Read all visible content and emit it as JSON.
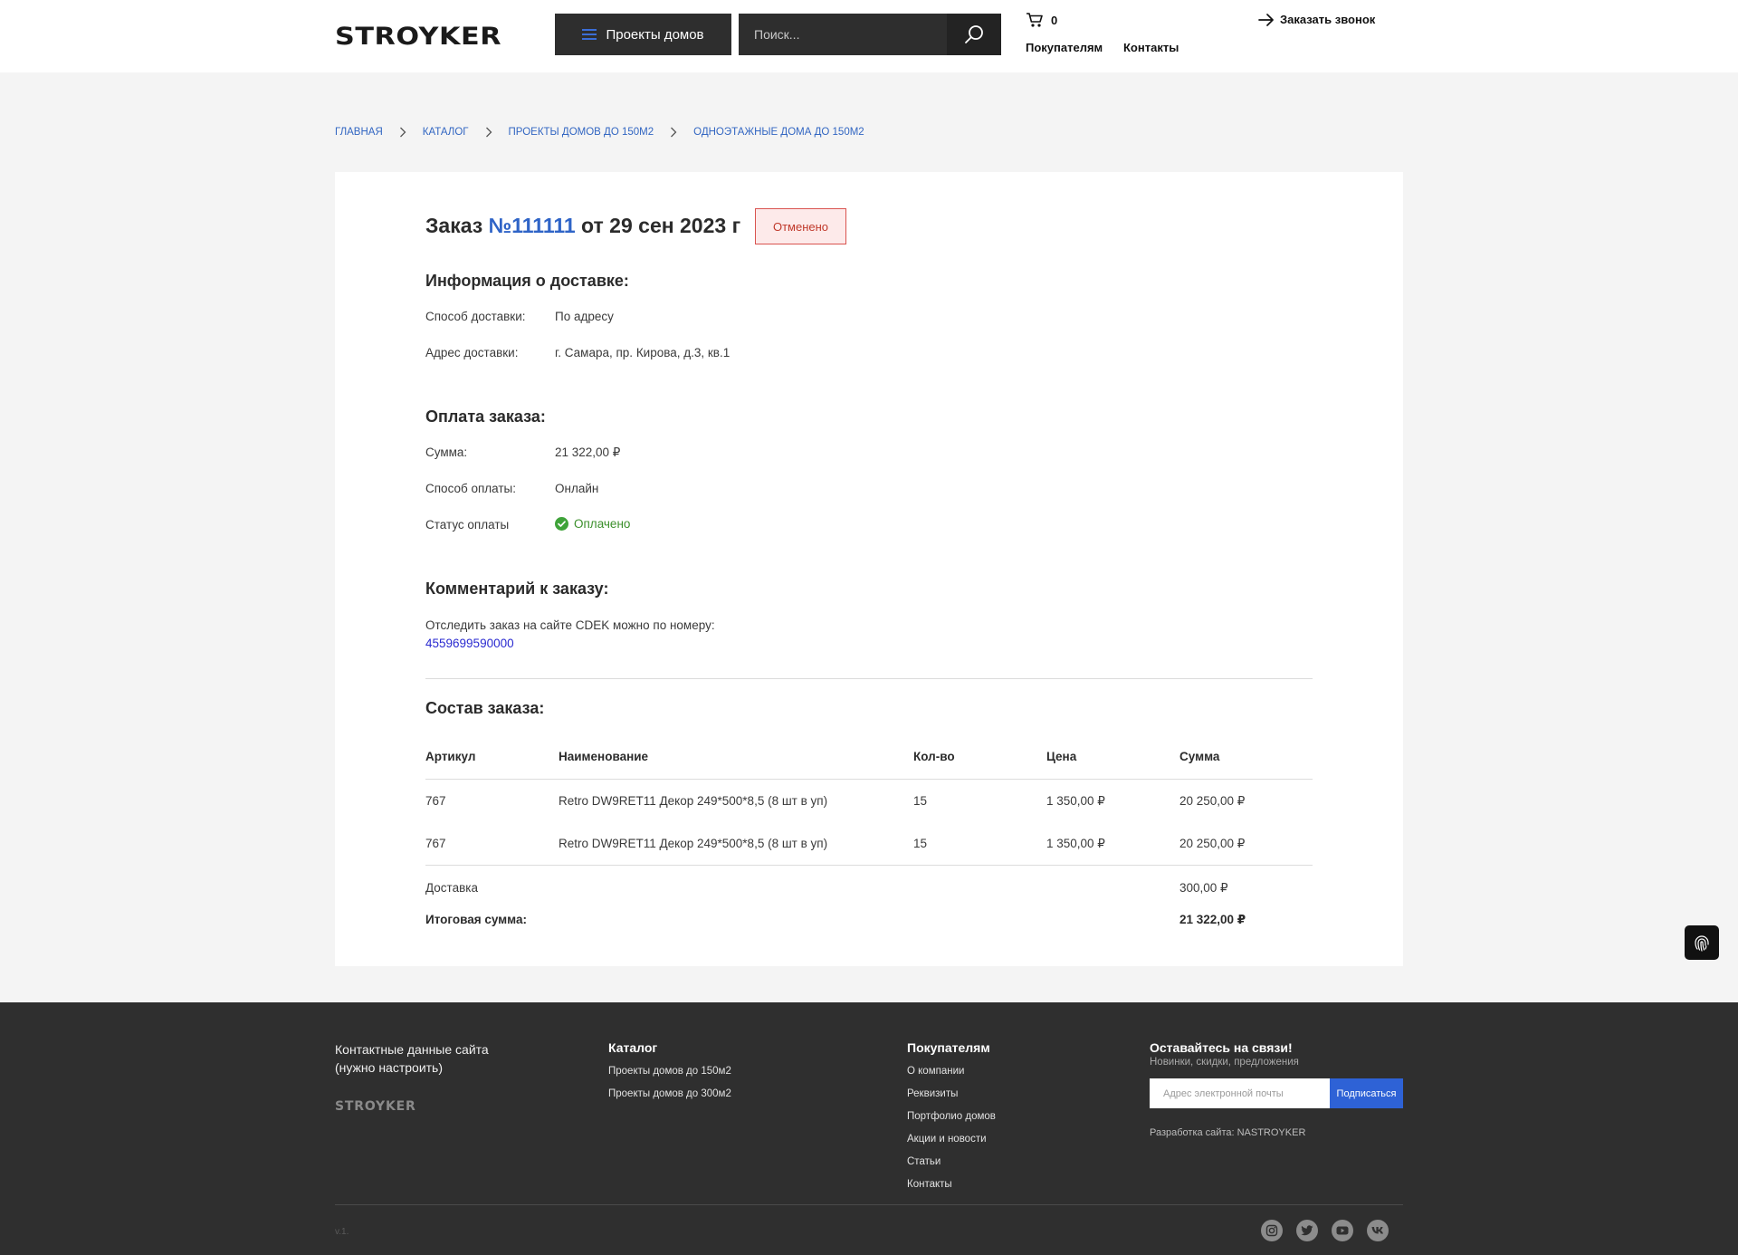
{
  "header": {
    "logo": "STROYKER",
    "catalog_button": "Проекты домов",
    "search_placeholder": "Поиск...",
    "cart_count": "0",
    "links": {
      "buyers": "Покупателям",
      "contacts": "Контакты"
    },
    "callback": "Заказать звонок"
  },
  "breadcrumb": [
    "ГЛАВНАЯ",
    "КАТАЛОГ",
    "ПРОЕКТЫ ДОМОВ ДО 150М2",
    "ОДНОЭТАЖНЫЕ ДОМА ДО 150М2"
  ],
  "order": {
    "title_prefix": "Заказ",
    "number": "№111111",
    "title_suffix": "от 29 сен 2023 г",
    "status": "Отменено",
    "delivery": {
      "heading": "Информация о доставке:",
      "method_label": "Способ доставки:",
      "method_value": "По адресу",
      "address_label": "Адрес доставки:",
      "address_value": "г. Самара, пр. Кирова, д.3, кв.1"
    },
    "payment": {
      "heading": "Оплата заказа:",
      "sum_label": "Сумма:",
      "sum_value": "21 322,00 ₽",
      "method_label": "Способ оплаты:",
      "method_value": "Онлайн",
      "status_label": "Статус оплаты",
      "status_value": "Оплачено"
    },
    "comment": {
      "heading": "Комментарий к заказу:",
      "text": "Отследить заказ на сайте CDEK можно по номеру:",
      "tracking": "4559699590000"
    },
    "composition": {
      "heading": "Состав заказа:",
      "columns": [
        "Артикул",
        "Наименование",
        "Кол-во",
        "Цена",
        "Сумма"
      ],
      "rows": [
        [
          "767",
          "Retro DW9RET11 Декор 249*500*8,5 (8 шт в уп)",
          "15",
          "1 350,00 ₽",
          "20 250,00 ₽"
        ],
        [
          "767",
          "Retro DW9RET11 Декор 249*500*8,5 (8 шт в уп)",
          "15",
          "1 350,00 ₽",
          "20 250,00 ₽"
        ]
      ],
      "delivery_label": "Доставка",
      "delivery_value": "300,00 ₽",
      "total_label": "Итоговая сумма:",
      "total_value": "21 322,00 ₽"
    }
  },
  "footer": {
    "contacts": [
      "Контактные данные сайта",
      "(нужно настроить)"
    ],
    "logo": "STROYKER",
    "catalog": {
      "heading": "Каталог",
      "links": [
        "Проекты домов до 150м2",
        "Проекты домов до 300м2"
      ]
    },
    "buyers": {
      "heading": "Покупателям",
      "links": [
        "О компании",
        "Реквизиты",
        "Портфолио домов",
        "Акции и новости",
        "Статьи",
        "Контакты"
      ]
    },
    "subscribe": {
      "heading": "Оставайтесь на связи!",
      "subtitle": "Новинки, скидки, предложения",
      "placeholder": "Адрес электронной почты",
      "button": "Подписаться"
    },
    "developer": "Разработка сайта: NASTROYKER",
    "version": "v.1.",
    "social_icons": [
      "instagram-icon",
      "twitter-icon",
      "youtube-icon",
      "vk-icon"
    ]
  },
  "colors": {
    "accent_blue": "#2f64c7",
    "status_cancelled": "#c0392b",
    "paid_green": "#3b8f2b",
    "footer_bg": "#2f2f2f",
    "header_dark": "#2e2e2e"
  }
}
